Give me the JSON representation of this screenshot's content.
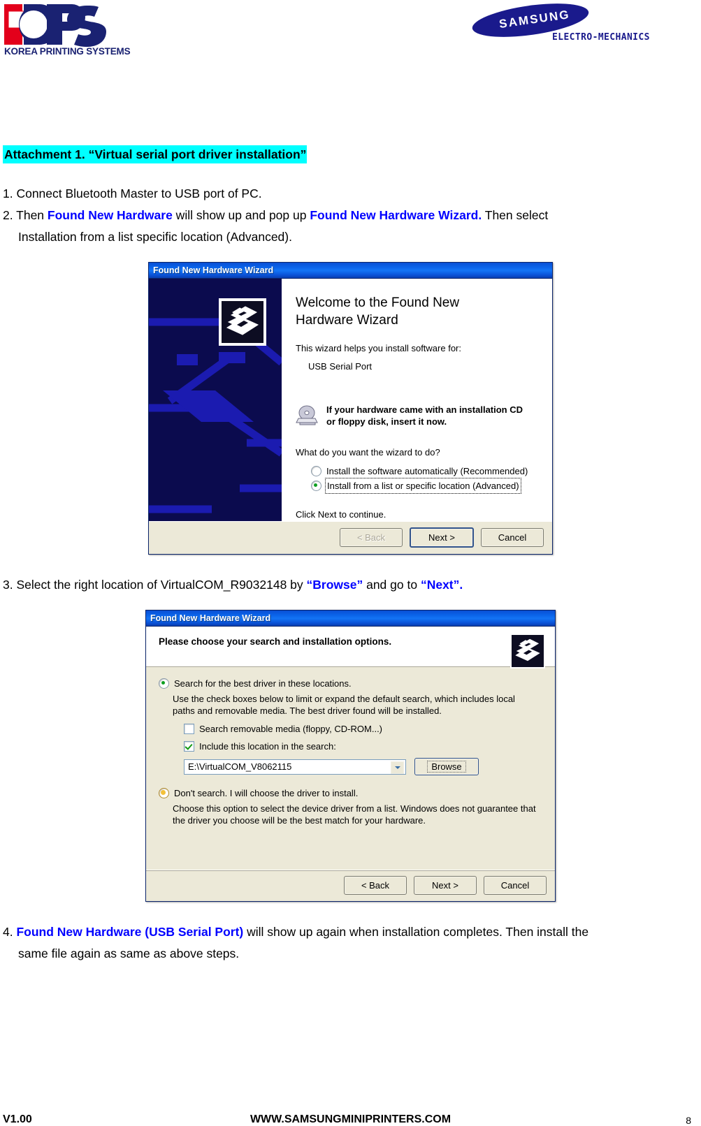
{
  "header": {
    "kps": {
      "mark_text": "KPS",
      "caption": "KOREA PRINTING SYSTEMS"
    },
    "samsung": {
      "word": "SAMSUNG",
      "sub": "ELECTRO-MECHANICS"
    }
  },
  "document": {
    "attachment_title": "Attachment 1. “Virtual serial port driver installation”",
    "step1": "1. Connect Bluetooth Master to USB port of PC.",
    "step2": {
      "prefix": "2. Then ",
      "highlight1": "Found New Hardware",
      "middle": " will show up and pop up ",
      "highlight2": "Found New Hardware Wizard.",
      "suffix": "   Then select",
      "line2": "Installation from a list specific location (Advanced)."
    },
    "step3": {
      "prefix": "3. Select the right location of VirtualCOM_R9032148 by ",
      "highlight1": "“Browse”",
      "middle": " and go to ",
      "highlight2": "“Next”."
    },
    "step4": {
      "prefix": "4. ",
      "highlight1": "Found New Hardware (USB Serial Port)",
      "suffix": " will show up again when installation completes. Then install the",
      "line2": "same file again as same as above steps."
    }
  },
  "dialog_welcome": {
    "title": "Found New Hardware Wizard",
    "heading_line1": "Welcome to the Found New",
    "heading_line2": "Hardware Wizard",
    "intro": "This wizard helps you install software for:",
    "device": "USB Serial Port",
    "cd_line1": "If your hardware came with an installation CD",
    "cd_line2": "or floppy disk, insert it now.",
    "question": "What do you want the wizard to do?",
    "options": [
      {
        "label": "Install the software automatically (Recommended)",
        "selected": false
      },
      {
        "label": "Install from a list or specific location (Advanced)",
        "selected": true
      }
    ],
    "click_next": "Click Next to continue.",
    "buttons": {
      "back": "< Back",
      "next": "Next >",
      "cancel": "Cancel"
    }
  },
  "dialog_options": {
    "title": "Found New Hardware Wizard",
    "header_title": "Please choose your search and installation options.",
    "option_search": {
      "label": "Search for the best driver in these locations.",
      "selected": true,
      "description_line1": "Use the check boxes below to limit or expand the default search, which includes local",
      "description_line2": "paths and removable media. The best driver found will be installed."
    },
    "checkbox_removable": {
      "label": "Search removable media (floppy, CD-ROM...)",
      "checked": false
    },
    "checkbox_location": {
      "label": "Include this location in the search:",
      "checked": true
    },
    "path_value": "E:\\VirtualCOM_V8062115",
    "browse_label": "Browse",
    "option_dontsearch": {
      "label": "Don't search. I will choose the driver to install.",
      "selected": false,
      "description_line1": "Choose this option to select the device driver from a list.  Windows does not guarantee that",
      "description_line2": "the driver you choose will be the best match for your hardware."
    },
    "buttons": {
      "back": "< Back",
      "next": "Next >",
      "cancel": "Cancel"
    }
  },
  "footer": {
    "version": "V1.00",
    "site": "WWW.SAMSUNGMINIPRINTERS.COM",
    "page": "8"
  },
  "colors": {
    "highlight_bg": "#00ffff",
    "link_blue": "#0000ff",
    "brand_navy": "#1a2272",
    "titlebar_blue": "#0a62e8"
  }
}
